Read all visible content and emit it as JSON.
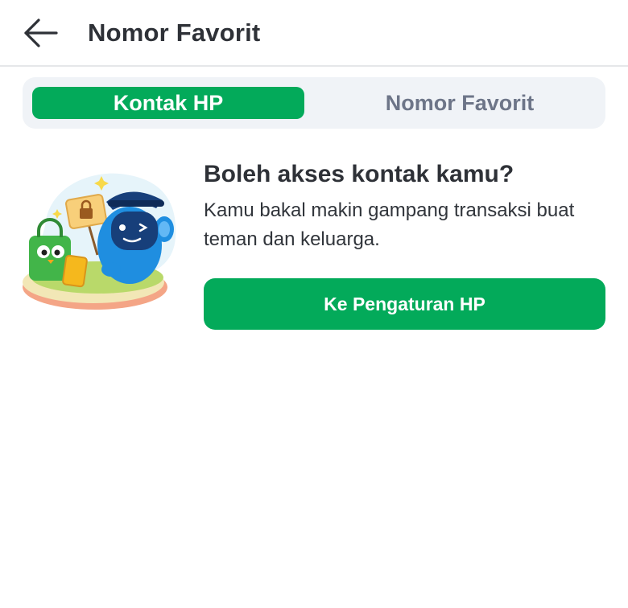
{
  "header": {
    "back_icon": "arrow-left-icon",
    "title": "Nomor Favorit"
  },
  "tabs": [
    {
      "label": "Kontak HP",
      "active": true
    },
    {
      "label": "Nomor Favorit",
      "active": false
    }
  ],
  "permission": {
    "illustration": "contacts-permission-illustration",
    "title": "Boleh akses kontak kamu?",
    "description": "Kamu bakal makin gampang transaksi buat teman dan keluarga.",
    "button_label": "Ke Pengaturan HP"
  },
  "colors": {
    "accent": "#03aa5a",
    "tab_background": "#f0f3f7",
    "text_primary": "#2e3137",
    "text_muted": "#6d7588"
  }
}
